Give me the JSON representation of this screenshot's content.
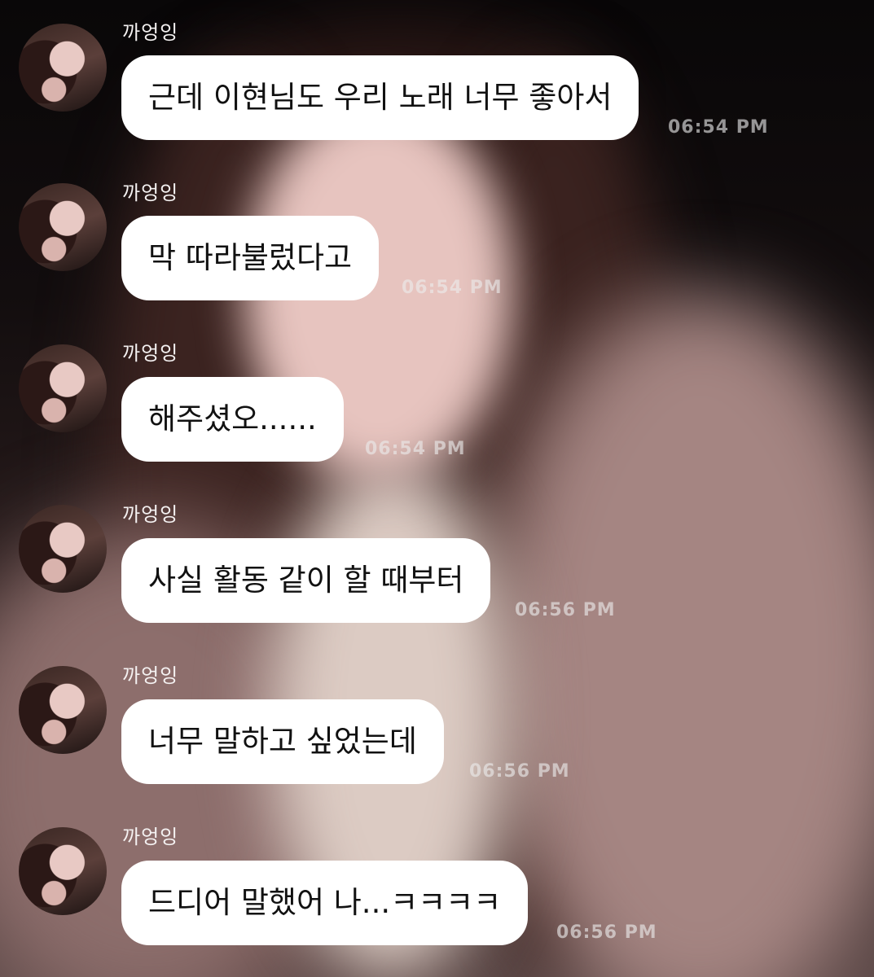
{
  "messages": [
    {
      "sender": "까엉잉",
      "text": "근데 이현님도 우리 노래 너무 좋아서",
      "time": "06:54 PM"
    },
    {
      "sender": "까엉잉",
      "text": "막 따라불렀다고",
      "time": "06:54 PM"
    },
    {
      "sender": "까엉잉",
      "text": "해주셨오......",
      "time": "06:54 PM"
    },
    {
      "sender": "까엉잉",
      "text": "사실 활동 같이 할 때부터",
      "time": "06:56 PM"
    },
    {
      "sender": "까엉잉",
      "text": "너무 말하고 싶었는데",
      "time": "06:56 PM"
    },
    {
      "sender": "까엉잉",
      "text": "드디어 말했어 나...ㅋㅋㅋㅋ",
      "time": "06:56 PM"
    }
  ]
}
